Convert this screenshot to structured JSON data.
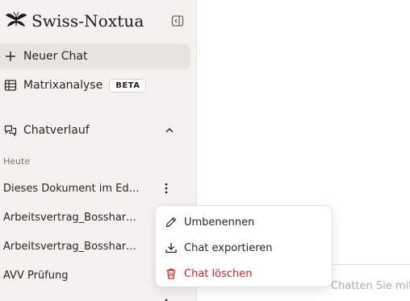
{
  "app": {
    "logo_text": "Swiss-Noxtua"
  },
  "sidebar": {
    "new_chat_label": "Neuer Chat",
    "matrix_label": "Matrixanalyse",
    "matrix_badge": "BETA",
    "history_label": "Chatverlauf",
    "group_today": "Heute",
    "chats": [
      {
        "title": "Dieses Dokument im Editor"
      },
      {
        "title": "Arbeitsvertrag_Bosshard.pdf"
      },
      {
        "title": "Arbeitsvertrag_Bosshard.pdf"
      },
      {
        "title": "AVV Prüfung"
      }
    ]
  },
  "context_menu": {
    "rename": "Umbenennen",
    "export": "Chat exportieren",
    "delete": "Chat löschen"
  },
  "main": {
    "input_placeholder": "Chatten Sie mit"
  },
  "colors": {
    "sidebar_bg": "#f4f2ef",
    "danger": "#c62828",
    "active_bg": "#e8e5e1"
  }
}
